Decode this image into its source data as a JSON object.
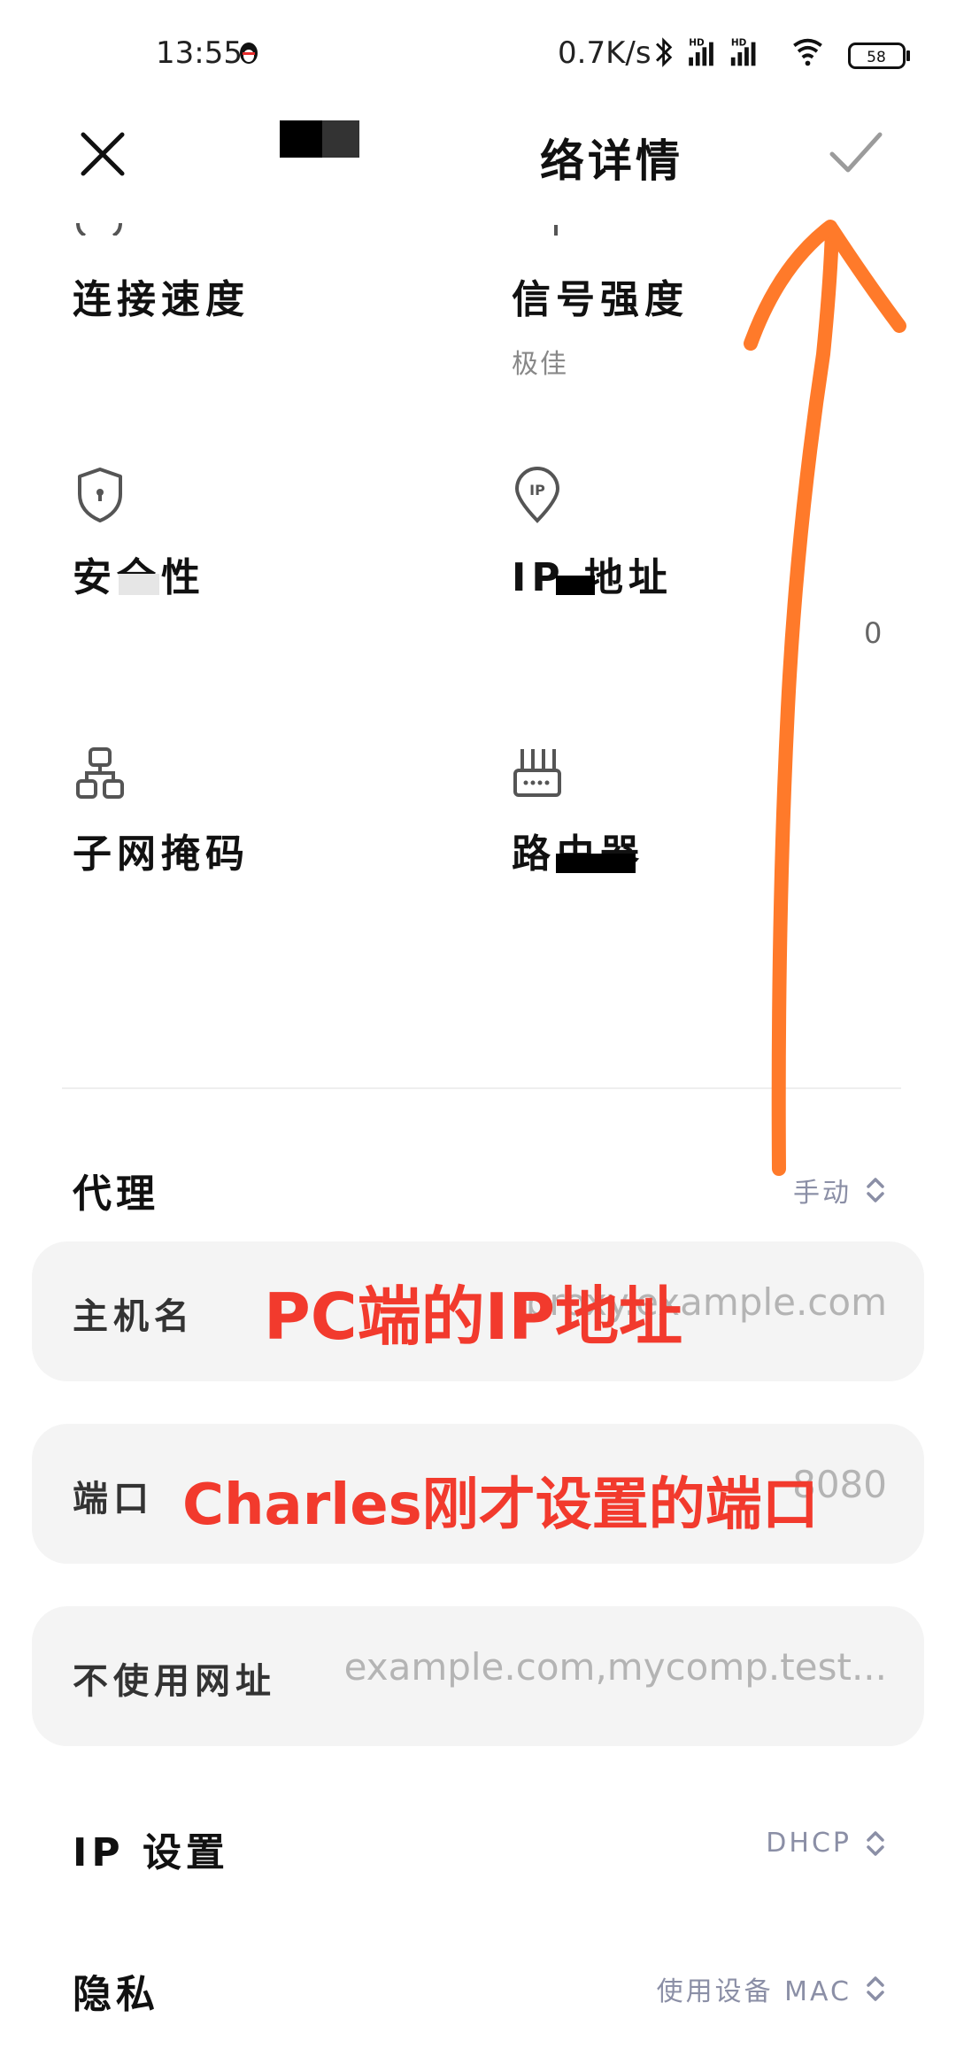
{
  "status_bar": {
    "time": "13:55",
    "net_speed": "0.7K/s",
    "signal1_label": "HD",
    "signal2_label": "HD",
    "battery": "58"
  },
  "header": {
    "title_visible": "络详情"
  },
  "grid": {
    "connection_speed": {
      "label": "连接速度"
    },
    "signal_strength": {
      "label": "信号强度",
      "value": "极佳"
    },
    "security": {
      "label_visible": "安全性"
    },
    "ip_address": {
      "label_visible": "IP 地址",
      "value_fragment": "0"
    },
    "subnet_mask": {
      "label": "子网掩码"
    },
    "router": {
      "label_visible": "路由器"
    }
  },
  "proxy": {
    "label": "代理",
    "value": "手动",
    "hostname": {
      "label": "主机名",
      "placeholder": "proxy.example.com"
    },
    "port": {
      "label": "端口",
      "placeholder": "8080"
    },
    "bypass": {
      "label": "不使用网址",
      "placeholder": "example.com,mycomp.test..."
    }
  },
  "ip_settings": {
    "label": "IP 设置",
    "value": "DHCP"
  },
  "privacy": {
    "label": "隐私",
    "value": "使用设备 MAC"
  },
  "annotations": {
    "hostname_note": "PC端的IP地址",
    "port_note": "Charles刚才设置的端口"
  },
  "colors": {
    "annotation_red": "#f23a2d",
    "arrow_orange": "#ff7a2a",
    "secondary_value": "#8b8fa6"
  }
}
